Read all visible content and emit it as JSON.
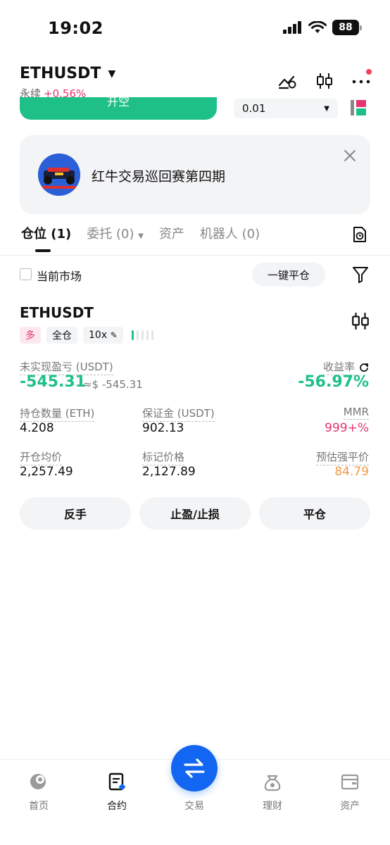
{
  "status_bar": {
    "time": "19:02",
    "battery": "88"
  },
  "header": {
    "pair": "ETHUSDT",
    "contract_type": "永续",
    "change": "+0.56%"
  },
  "trade_row": {
    "open_label": "开空",
    "quantity": "0.01"
  },
  "banner": {
    "text": "红牛交易巡回赛第四期"
  },
  "tabs": [
    {
      "label": "仓位 (1)"
    },
    {
      "label": "委托 (0)"
    },
    {
      "label": "资产"
    },
    {
      "label": "机器人 (0)"
    }
  ],
  "filter": {
    "current_market": "当前市场",
    "close_all": "一键平仓"
  },
  "position": {
    "symbol": "ETHUSDT",
    "side": "多",
    "margin_mode": "全仓",
    "leverage": "10x",
    "leverage_level": 0.2,
    "unrealized_pnl_label": "未实现盈亏 (USDT)",
    "unrealized_pnl": "-545.31",
    "unrealized_pnl_usd": "≈$ -545.31",
    "roe_label": "收益率",
    "roe": "-56.97%",
    "size_label": "持仓数量 (ETH)",
    "size": "4.208",
    "margin_label": "保证金 (USDT)",
    "margin": "902.13",
    "mmr_label": "MMR",
    "mmr": "999+%",
    "entry_label": "开仓均价",
    "entry": "2,257.49",
    "mark_label": "标记价格",
    "mark": "2,127.89",
    "liq_label": "预估强平价",
    "liq": "84.79"
  },
  "actions": {
    "reverse": "反手",
    "tp_sl": "止盈/止损",
    "close": "平仓"
  },
  "bottom_nav": {
    "home": "首页",
    "futures": "合约",
    "trade": "交易",
    "earn": "理财",
    "assets": "资产"
  },
  "colors": {
    "green": "#1fc087",
    "red": "#e5356f",
    "orange": "#f29a4a",
    "blue": "#1266f1"
  }
}
